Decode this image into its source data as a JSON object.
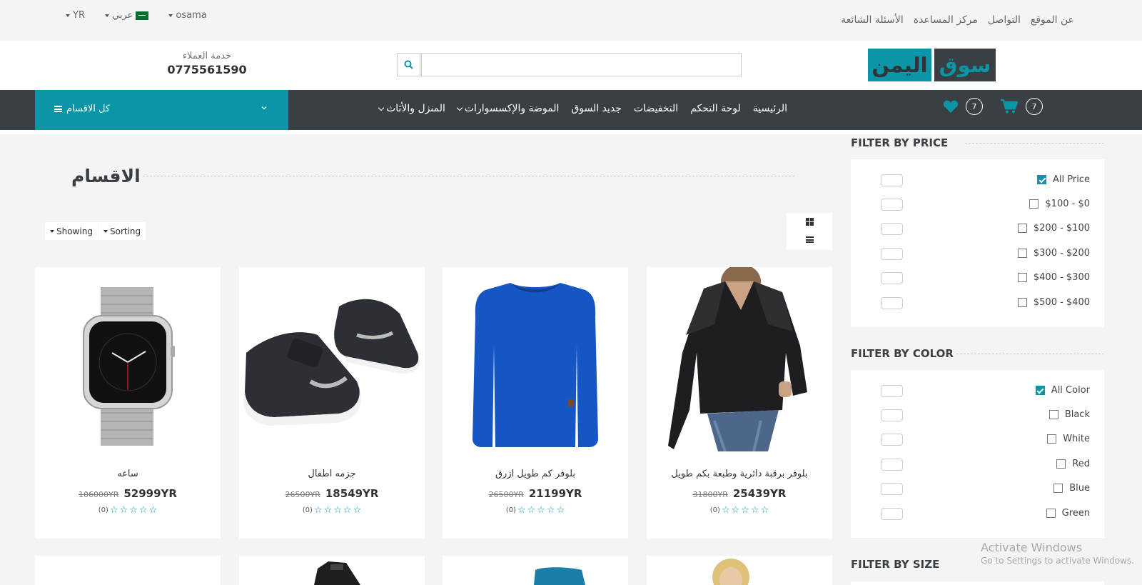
{
  "topbar": {
    "currency": "YR",
    "language": "عربي",
    "user": "osama",
    "links": [
      "عن الموقع",
      "التواصل",
      "مركز المساعدة",
      "الأسئلة الشائعة"
    ]
  },
  "header": {
    "logo_part1": "اليمن",
    "logo_part2": "سوق",
    "customer_service_label": "خدمة العملاء",
    "customer_service_phone": "0775561590",
    "search_placeholder": ""
  },
  "nav": {
    "all_categories": "كل الاقسام",
    "items": [
      "الرئيسية",
      "لوحة التحكم",
      "التخفيضات",
      "جديد السوق",
      "الموضة والإكسسوارات",
      "المنزل والأثاث"
    ],
    "cart_count": "7",
    "wishlist_count": "7"
  },
  "main": {
    "title": "الاقسام",
    "showing_label": "Showing",
    "sorting_label": "Sorting",
    "products": [
      {
        "name": "ساعه",
        "old_price": "106000YR",
        "new_price": "52999YR",
        "reviews": "(0)",
        "image": "watch"
      },
      {
        "name": "جزمه اطفال",
        "old_price": "26500YR",
        "new_price": "18549YR",
        "reviews": "(0)",
        "image": "kids-shoes"
      },
      {
        "name": "بلوفر كم طويل ازرق",
        "old_price": "26500YR",
        "new_price": "21199YR",
        "reviews": "(0)",
        "image": "blue-sweater"
      },
      {
        "name": "بلوفر برقبة دائرية وطبعة بكم طويل",
        "old_price": "31800YR",
        "new_price": "25439YR",
        "reviews": "(0)",
        "image": "black-blouse"
      }
    ]
  },
  "filters": {
    "price_title": "FILTER BY PRICE",
    "price_options": [
      "All Price",
      "$100 - $0",
      "$200 - $100",
      "$300 - $200",
      "$400 - $300",
      "$500 - $400"
    ],
    "color_title": "FILTER BY COLOR",
    "color_options": [
      "All Color",
      "Black",
      "White",
      "Red",
      "Blue",
      "Green"
    ],
    "size_title": "FILTER BY SIZE"
  },
  "watermark": {
    "line1": "Activate Windows",
    "line2": "Go to Settings to activate Windows."
  },
  "colors": {
    "accent": "#0b95a6",
    "dark": "#3a3f44",
    "background": "#f4f4f4"
  }
}
